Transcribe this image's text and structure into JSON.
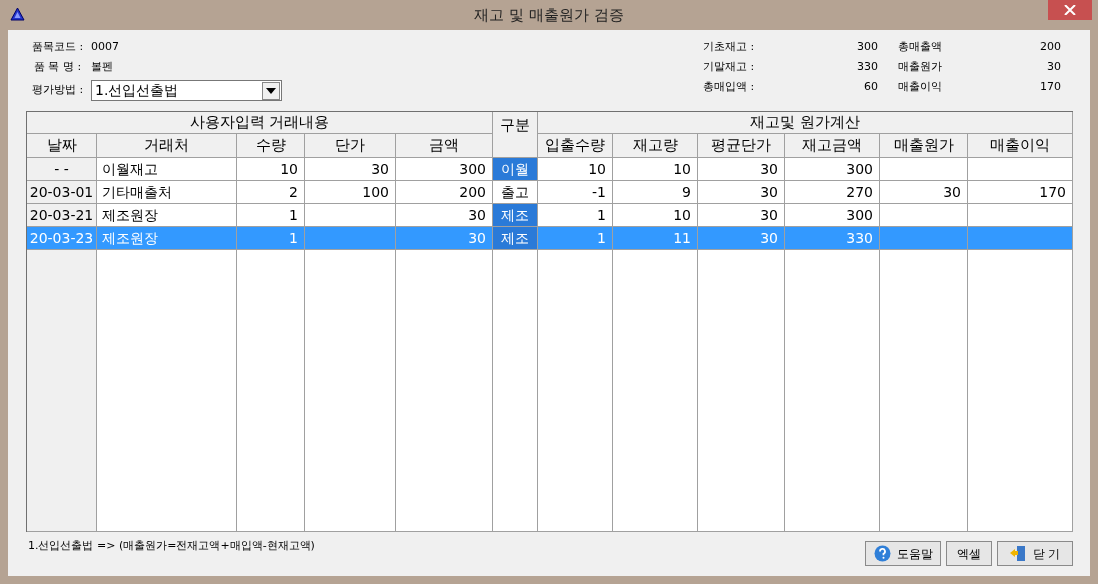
{
  "window": {
    "title": "재고 및 매출원가 검증"
  },
  "item_info": [
    {
      "label": "품목코드 :",
      "value": "0007"
    },
    {
      "label": "품 목 명 :",
      "value": "볼펜"
    }
  ],
  "method": {
    "label": "평가방법 :",
    "value": "1.선입선출법"
  },
  "summary": [
    {
      "label": "기초재고 :",
      "value": "300",
      "label_2": "총매출액",
      "value_2": "200"
    },
    {
      "label": "기말재고 :",
      "value": "330",
      "label_2": "매출원가",
      "value_2": "30"
    },
    {
      "label": "총매입액 :",
      "value": "60",
      "label_2": "매출이익",
      "value_2": "170"
    }
  ],
  "table": {
    "group_headers": [
      "사용자입력 거래내용",
      "구분",
      "재고및 원가계산"
    ],
    "columns": [
      "날짜",
      "거래처",
      "수량",
      "단가",
      "금액",
      "입출수량",
      "재고량",
      "평균단가",
      "재고금액",
      "매출원가",
      "매출이익"
    ],
    "rows": [
      {
        "selected": false,
        "date": "-  -",
        "partner": "이월재고",
        "qty": "10",
        "price": "30",
        "amount": "300",
        "category": {
          "text": "이월",
          "highlighted": true
        },
        "io_qty": "10",
        "stock_qty": "10",
        "avg_price": "30",
        "stock_amount": "300",
        "cost": "",
        "profit": ""
      },
      {
        "selected": false,
        "date": "20-03-01",
        "partner": "기타매출처",
        "qty": "2",
        "price": "100",
        "amount": "200",
        "category": {
          "text": "출고",
          "highlighted": false
        },
        "io_qty": "-1",
        "stock_qty": "9",
        "avg_price": "30",
        "stock_amount": "270",
        "cost": "30",
        "profit": "170"
      },
      {
        "selected": false,
        "date": "20-03-21",
        "partner": "제조원장",
        "qty": "1",
        "price": "",
        "amount": "30",
        "category": {
          "text": "제조",
          "highlighted": true
        },
        "io_qty": "1",
        "stock_qty": "10",
        "avg_price": "30",
        "stock_amount": "300",
        "cost": "",
        "profit": ""
      },
      {
        "selected": true,
        "date": "20-03-23",
        "partner": "제조원장",
        "qty": "1",
        "price": "",
        "amount": "30",
        "category": {
          "text": "제조",
          "highlighted": true
        },
        "io_qty": "1",
        "stock_qty": "11",
        "avg_price": "30",
        "stock_amount": "330",
        "cost": "",
        "profit": ""
      }
    ]
  },
  "footnote": "1.선입선출법 => (매출원가=전재고액+매입액-현재고액)",
  "buttons": [
    {
      "kind": "help",
      "label": "도움말"
    },
    {
      "kind": "plain",
      "label": "엑셀"
    },
    {
      "kind": "close",
      "label": "닫 기"
    }
  ]
}
